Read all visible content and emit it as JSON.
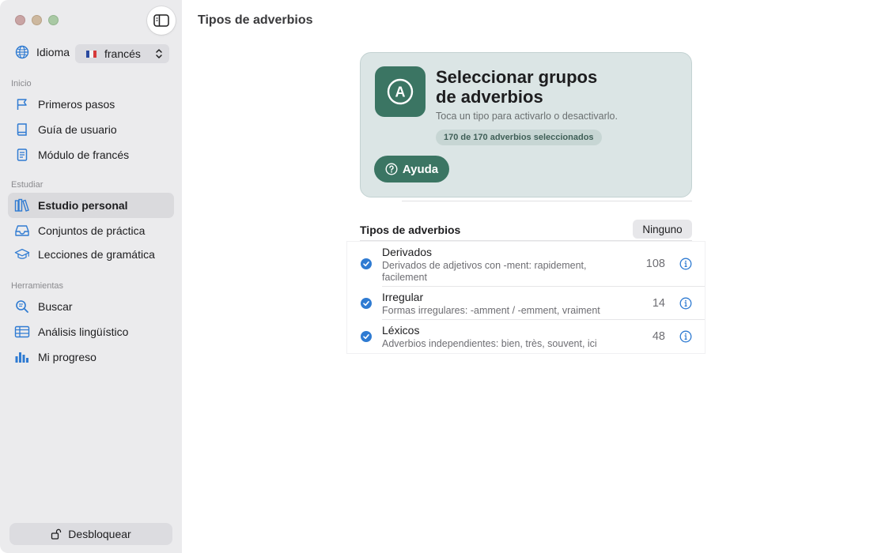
{
  "window": {
    "title": "Tipos de adverbios"
  },
  "sidebar": {
    "language": {
      "label": "Idioma",
      "value": "francés"
    },
    "sections": [
      {
        "title": "Inicio",
        "items": [
          {
            "label": "Primeros pasos",
            "icon": "flag-icon"
          },
          {
            "label": "Guía de usuario",
            "icon": "book-icon"
          },
          {
            "label": "Módulo de francés",
            "icon": "document-icon"
          }
        ]
      },
      {
        "title": "Estudiar",
        "items": [
          {
            "label": "Estudio personal",
            "icon": "books-icon",
            "active": true
          },
          {
            "label": "Conjuntos de práctica",
            "icon": "tray-icon"
          },
          {
            "label": "Lecciones de gramática",
            "icon": "graduation-cap-icon"
          }
        ]
      },
      {
        "title": "Herramientas",
        "items": [
          {
            "label": "Buscar",
            "icon": "search-icon"
          },
          {
            "label": "Análisis lingüístico",
            "icon": "table-icon"
          },
          {
            "label": "Mi progreso",
            "icon": "bar-chart-icon"
          }
        ]
      }
    ],
    "unlock_label": "Desbloquear"
  },
  "hero": {
    "icon_letter": "A",
    "title_line1": "Seleccionar grupos",
    "title_line2": "de adverbios",
    "subtitle": "Toca un tipo para activarlo o desactivarlo.",
    "pill": "170 de 170 adverbios seleccionados",
    "help_label": "Ayuda"
  },
  "list": {
    "title": "Tipos de adverbios",
    "none_label": "Ninguno",
    "rows": [
      {
        "name": "Derivados",
        "desc": "Derivados de adjetivos con -ment: rapidement, facilement",
        "count": "108",
        "checked": true
      },
      {
        "name": "Irregular",
        "desc": "Formas irregulares: -amment / -emment, vraiment",
        "count": "14",
        "checked": true
      },
      {
        "name": "Léxicos",
        "desc": "Adverbios independientes: bien, très, souvent, ici",
        "count": "48",
        "checked": true
      }
    ]
  },
  "colors": {
    "accent": "#3b7563",
    "check": "#2f7bd2",
    "sidebar_bg": "#ebebed",
    "hero_bg": "#dbe5e5"
  }
}
